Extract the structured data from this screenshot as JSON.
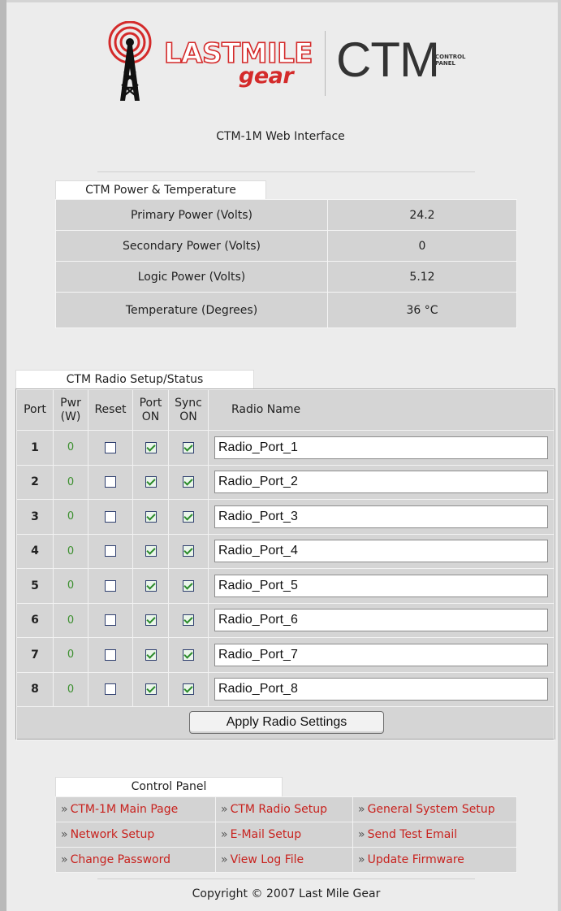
{
  "logo": {
    "brand_line1": "LASTMILE",
    "brand_line2": "gear",
    "product": "CTM",
    "product_sub_line1": "CONTROL",
    "product_sub_line2": "PANEL"
  },
  "page_subtitle": "CTM-1M Web Interface",
  "power": {
    "section_title": "CTM Power & Temperature",
    "rows": [
      {
        "label": "Primary Power (Volts)",
        "value": "24.2"
      },
      {
        "label": "Secondary Power (Volts)",
        "value": "0"
      },
      {
        "label": "Logic Power (Volts)",
        "value": "5.12"
      },
      {
        "label": "Temperature (Degrees)",
        "value": "36 °C"
      }
    ]
  },
  "radio": {
    "section_title": "CTM Radio Setup/Status",
    "headers": {
      "port": "Port",
      "pwr_line1": "Pwr",
      "pwr_line2": "(W)",
      "reset": "Reset",
      "port_on_line1": "Port",
      "port_on_line2": "ON",
      "sync_on_line1": "Sync",
      "sync_on_line2": "ON",
      "radio_name": "Radio Name"
    },
    "rows": [
      {
        "port": "1",
        "pwr": "0",
        "reset": false,
        "port_on": true,
        "sync_on": true,
        "name": "Radio_Port_1"
      },
      {
        "port": "2",
        "pwr": "0",
        "reset": false,
        "port_on": true,
        "sync_on": true,
        "name": "Radio_Port_2"
      },
      {
        "port": "3",
        "pwr": "0",
        "reset": false,
        "port_on": true,
        "sync_on": true,
        "name": "Radio_Port_3"
      },
      {
        "port": "4",
        "pwr": "0",
        "reset": false,
        "port_on": true,
        "sync_on": true,
        "name": "Radio_Port_4"
      },
      {
        "port": "5",
        "pwr": "0",
        "reset": false,
        "port_on": true,
        "sync_on": true,
        "name": "Radio_Port_5"
      },
      {
        "port": "6",
        "pwr": "0",
        "reset": false,
        "port_on": true,
        "sync_on": true,
        "name": "Radio_Port_6"
      },
      {
        "port": "7",
        "pwr": "0",
        "reset": false,
        "port_on": true,
        "sync_on": true,
        "name": "Radio_Port_7"
      },
      {
        "port": "8",
        "pwr": "0",
        "reset": false,
        "port_on": true,
        "sync_on": true,
        "name": "Radio_Port_8"
      }
    ],
    "apply_label": "Apply Radio Settings"
  },
  "control_panel": {
    "section_title": "Control Panel",
    "arrow": "»",
    "links": [
      [
        "CTM-1M Main Page",
        "CTM Radio Setup",
        "General System Setup"
      ],
      [
        "Network Setup",
        "E-Mail Setup",
        "Send Test Email"
      ],
      [
        "Change Password",
        "View Log File",
        "Update Firmware"
      ]
    ]
  },
  "copyright": "Copyright © 2007 Last Mile Gear",
  "colors": {
    "brand_red": "#d42a2a",
    "link_red": "#c8221e",
    "pwr_green": "#3b8f2e",
    "table_gray": "#d3d3d3"
  }
}
